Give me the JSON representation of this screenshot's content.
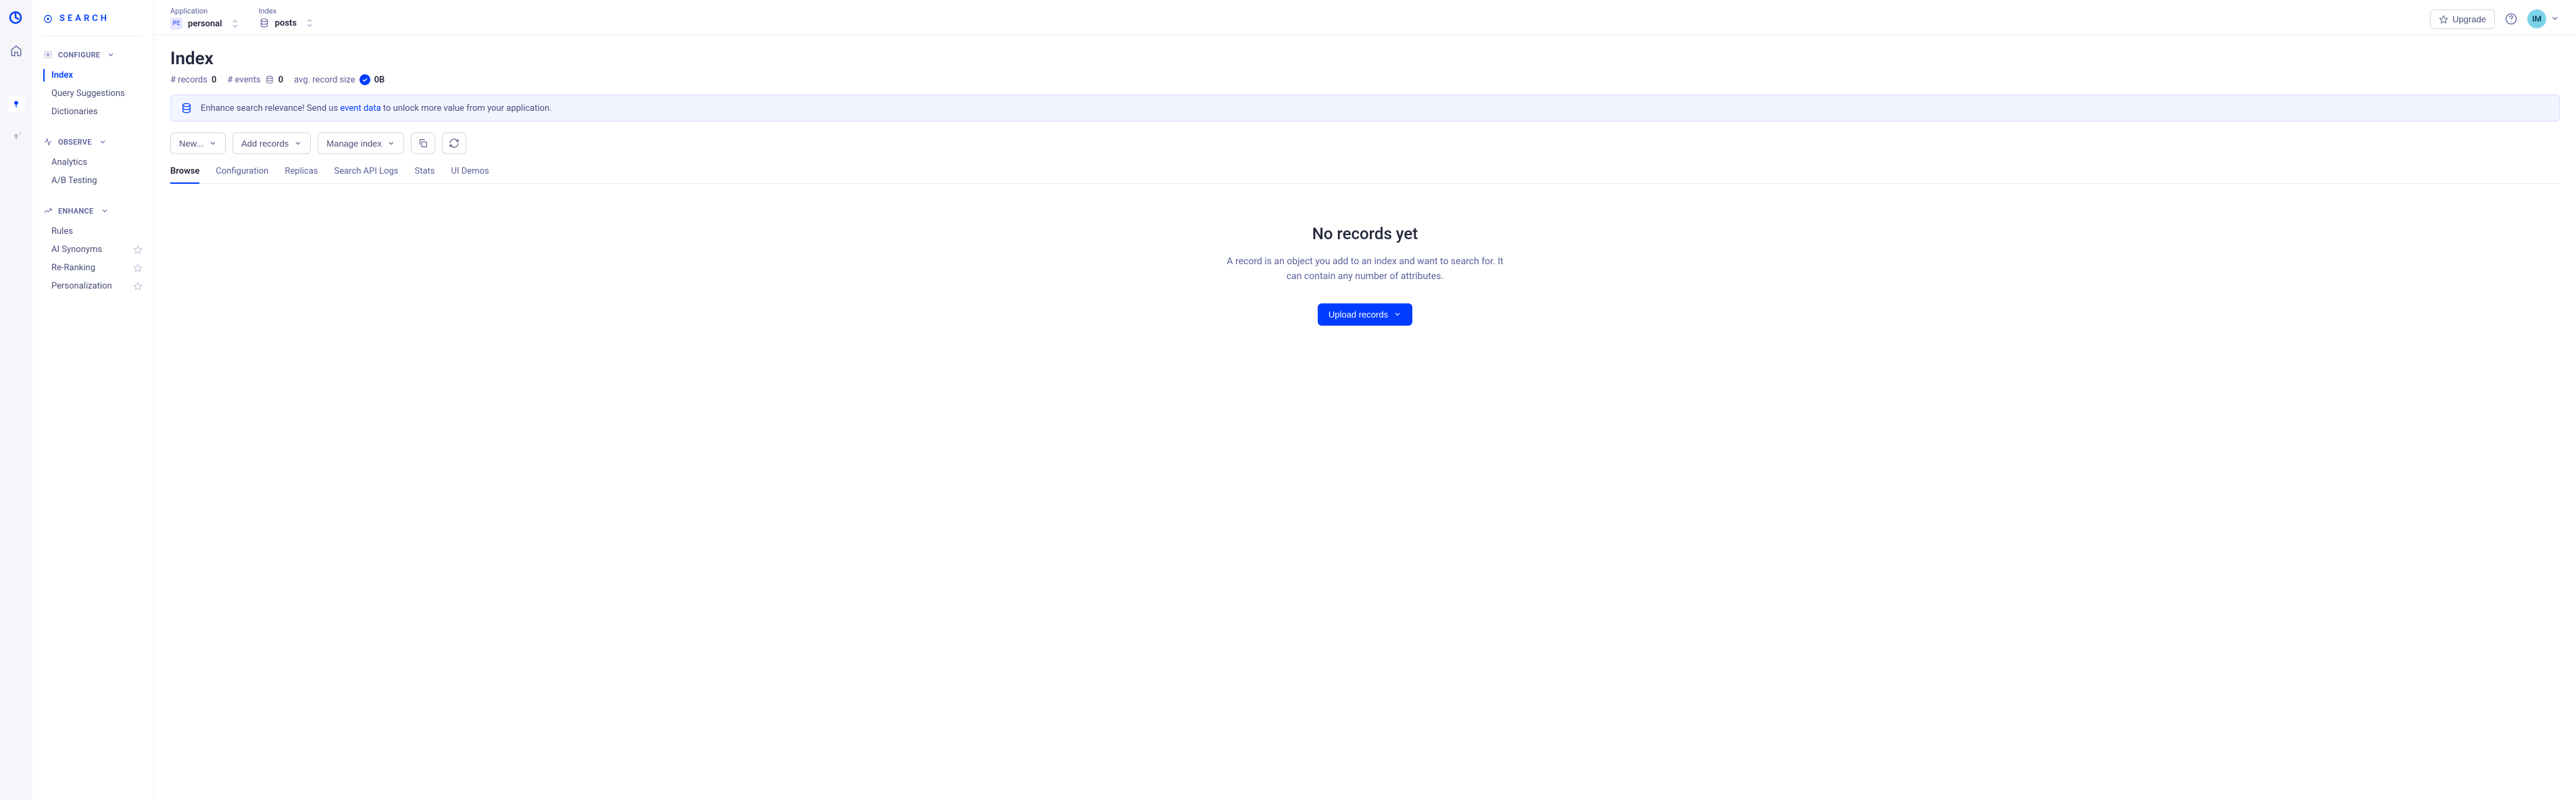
{
  "brand": "SEARCH",
  "topbar": {
    "application_label": "Application",
    "application_value": "personal",
    "application_badge": "PE",
    "index_label": "Index",
    "index_value": "posts",
    "upgrade": "Upgrade",
    "avatar": "IM"
  },
  "sidebar": {
    "configure": {
      "label": "CONFIGURE",
      "items": [
        "Index",
        "Query Suggestions",
        "Dictionaries"
      ],
      "active": 0
    },
    "observe": {
      "label": "OBSERVE",
      "items": [
        "Analytics",
        "A/B Testing"
      ]
    },
    "enhance": {
      "label": "ENHANCE",
      "items": [
        {
          "label": "Rules",
          "star": false
        },
        {
          "label": "AI Synonyms",
          "star": true
        },
        {
          "label": "Re-Ranking",
          "star": true
        },
        {
          "label": "Personalization",
          "star": true
        }
      ]
    }
  },
  "page": {
    "title": "Index",
    "stats": {
      "records_label": "# records",
      "records_value": "0",
      "events_label": "# events",
      "events_value": "0",
      "avg_label": "avg. record size",
      "avg_value": "0B"
    },
    "banner": {
      "prefix": "Enhance search relevance! Send us ",
      "link": "event data",
      "suffix": " to unlock more value from your application."
    },
    "actions": {
      "new": "New...",
      "add": "Add records",
      "manage": "Manage index"
    },
    "tabs": [
      "Browse",
      "Configuration",
      "Replicas",
      "Search API Logs",
      "Stats",
      "UI Demos"
    ],
    "active_tab": 0,
    "empty": {
      "title": "No records yet",
      "body": "A record is an object you add to an index and want to search for. It can contain any number of attributes.",
      "button": "Upload records"
    }
  }
}
